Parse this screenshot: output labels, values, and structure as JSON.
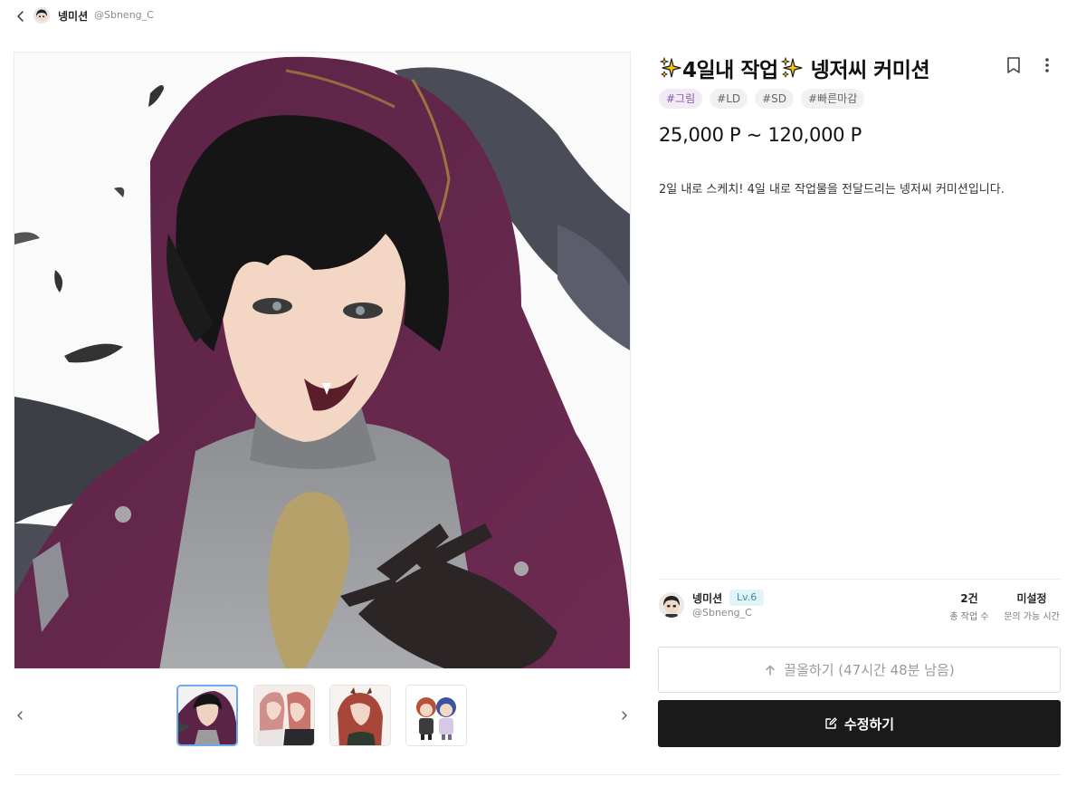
{
  "topbar": {
    "back_icon": "chevron-left-icon",
    "name": "넹미션",
    "handle": "@Sbneng_C"
  },
  "gallery": {
    "prev_icon": "chevron-left-icon",
    "next_icon": "chevron-right-icon",
    "active_index": 0,
    "thumbnail_count": 4
  },
  "product": {
    "title_text": "4일내 작업",
    "title_suffix": "넹저씨 커미션",
    "sparkle_icon": "sparkles-icon",
    "tags": [
      "#그림",
      "#LD",
      "#SD",
      "#빠른마감"
    ],
    "price": "25,000 P ~ 120,000 P",
    "description": "2일 내로 스케치! 4일 내로 작업물을 전달드리는 넹저씨 커미션입니다."
  },
  "author": {
    "name": "넹미션",
    "level": "Lv.6",
    "handle": "@Sbneng_C",
    "stats": [
      {
        "value": "2건",
        "label": "총 작업 수"
      },
      {
        "value": "미설정",
        "label": "문의 가능 시간"
      }
    ]
  },
  "actions": {
    "pull_label": "끌올하기 (47시간 48분 남음)",
    "edit_label": "수정하기"
  },
  "colors": {
    "accent_tag_bg": "#f2ebf6",
    "level_badge_bg": "#e3f4f8",
    "primary_button": "#1a1a1a",
    "active_thumb_border": "#6fa8ef"
  }
}
